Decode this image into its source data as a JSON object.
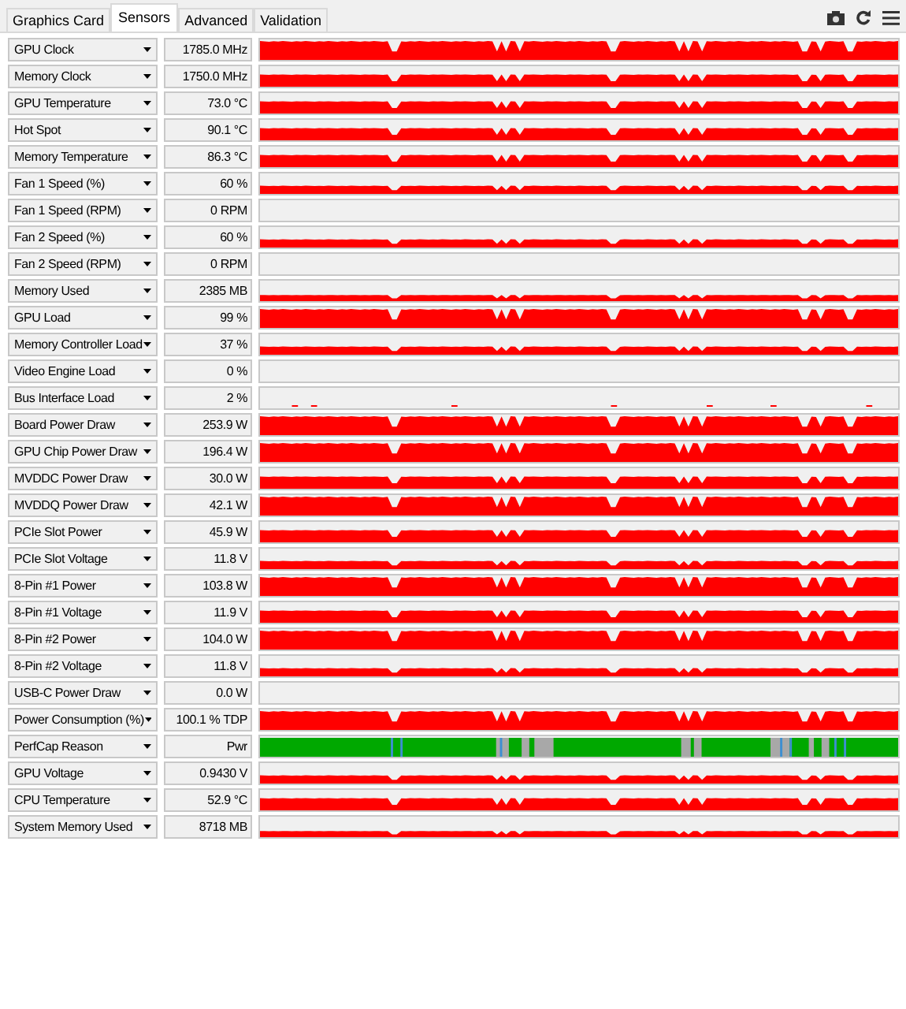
{
  "tabs": [
    {
      "label": "Graphics Card",
      "selected": false
    },
    {
      "label": "Sensors",
      "selected": true
    },
    {
      "label": "Advanced",
      "selected": false
    },
    {
      "label": "Validation",
      "selected": false
    }
  ],
  "sensors": [
    {
      "name": "GPU Clock",
      "value": "1785.0 MHz",
      "kind": "high"
    },
    {
      "name": "Memory Clock",
      "value": "1750.0 MHz",
      "kind": "mid"
    },
    {
      "name": "GPU Temperature",
      "value": "73.0 °C",
      "kind": "mid"
    },
    {
      "name": "Hot Spot",
      "value": "90.1 °C",
      "kind": "mid"
    },
    {
      "name": "Memory Temperature",
      "value": "86.3 °C",
      "kind": "mid"
    },
    {
      "name": "Fan 1 Speed (%)",
      "value": "60 %",
      "kind": "low"
    },
    {
      "name": "Fan 1 Speed (RPM)",
      "value": "0 RPM",
      "kind": "empty"
    },
    {
      "name": "Fan 2 Speed (%)",
      "value": "60 %",
      "kind": "low"
    },
    {
      "name": "Fan 2 Speed (RPM)",
      "value": "0 RPM",
      "kind": "empty"
    },
    {
      "name": "Memory Used",
      "value": "2385 MB",
      "kind": "line"
    },
    {
      "name": "GPU Load",
      "value": "99 %",
      "kind": "high"
    },
    {
      "name": "Memory Controller Load",
      "value": "37 %",
      "kind": "low"
    },
    {
      "name": "Video Engine Load",
      "value": "0 %",
      "kind": "empty"
    },
    {
      "name": "Bus Interface Load",
      "value": "2 %",
      "kind": "specks"
    },
    {
      "name": "Board Power Draw",
      "value": "253.9 W",
      "kind": "high"
    },
    {
      "name": "GPU Chip Power Draw",
      "value": "196.4 W",
      "kind": "high"
    },
    {
      "name": "MVDDC Power Draw",
      "value": "30.0 W",
      "kind": "mid"
    },
    {
      "name": "MVDDQ Power Draw",
      "value": "42.1 W",
      "kind": "high"
    },
    {
      "name": "PCIe Slot Power",
      "value": "45.9 W",
      "kind": "mid"
    },
    {
      "name": "PCIe Slot Voltage",
      "value": "11.8 V",
      "kind": "low"
    },
    {
      "name": "8-Pin #1 Power",
      "value": "103.8 W",
      "kind": "high"
    },
    {
      "name": "8-Pin #1 Voltage",
      "value": "11.9 V",
      "kind": "mid"
    },
    {
      "name": "8-Pin #2 Power",
      "value": "104.0 W",
      "kind": "high"
    },
    {
      "name": "8-Pin #2 Voltage",
      "value": "11.8 V",
      "kind": "low"
    },
    {
      "name": "USB-C Power Draw",
      "value": "0.0 W",
      "kind": "empty"
    },
    {
      "name": "Power Consumption (%)",
      "value": "100.1 % TDP",
      "kind": "high"
    },
    {
      "name": "PerfCap Reason",
      "value": "Pwr",
      "kind": "perfcap"
    },
    {
      "name": "GPU Voltage",
      "value": "0.9430 V",
      "kind": "low"
    },
    {
      "name": "CPU Temperature",
      "value": "52.9 °C",
      "kind": "mid"
    },
    {
      "name": "System Memory Used",
      "value": "8718 MB",
      "kind": "line"
    }
  ]
}
